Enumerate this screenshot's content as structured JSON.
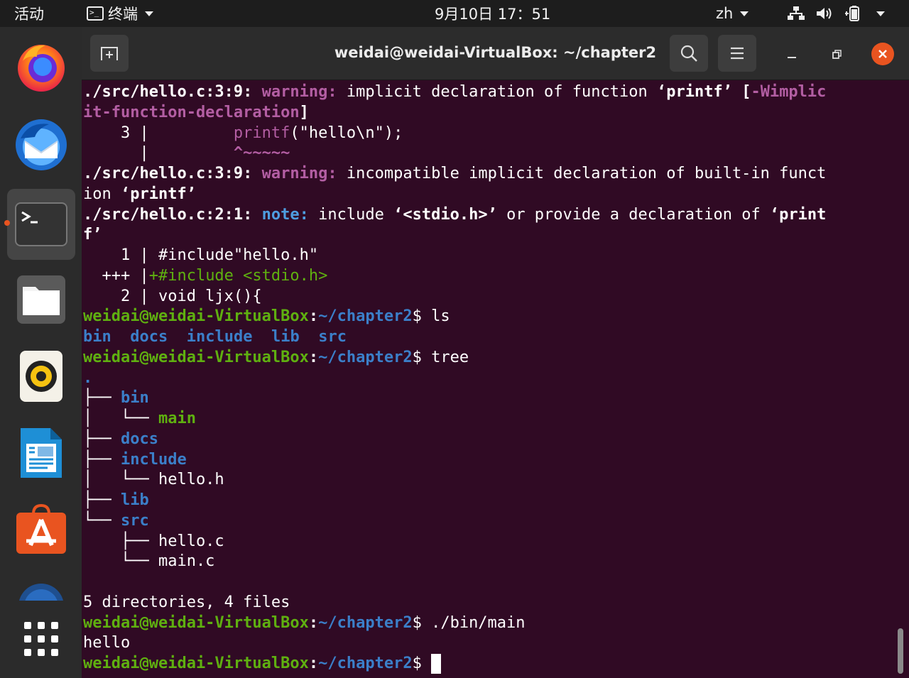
{
  "topbar": {
    "activities": "活动",
    "app_menu": "终端",
    "clock": "9月10日  17：51",
    "input_method": "zh"
  },
  "dock": {
    "items": [
      {
        "name": "firefox"
      },
      {
        "name": "thunderbird"
      },
      {
        "name": "terminal",
        "active": true
      },
      {
        "name": "files"
      },
      {
        "name": "rhythmbox"
      },
      {
        "name": "libreoffice-writer"
      },
      {
        "name": "ubuntu-software"
      },
      {
        "name": "help"
      },
      {
        "name": "show-applications"
      }
    ]
  },
  "window": {
    "title": "weidai@weidai-VirtualBox: ~/chapter2"
  },
  "terminal": {
    "prompt_user": "weidai@weidai-VirtualBox",
    "prompt_path": "~/chapter2",
    "lines": [
      {
        "segs": [
          {
            "t": "./src/hello.c:3:9: ",
            "c": "b"
          },
          {
            "t": "warning: ",
            "c": "warn"
          },
          {
            "t": "implicit declaration of function "
          },
          {
            "t": "‘printf’",
            "c": "b"
          },
          {
            "t": " [",
            "c": "b"
          },
          {
            "t": "-Wimplic",
            "c": "warn"
          }
        ]
      },
      {
        "segs": [
          {
            "t": "it-function-declaration",
            "c": "warn"
          },
          {
            "t": "]",
            "c": "b"
          }
        ]
      },
      {
        "segs": [
          {
            "t": "    3 |         "
          },
          {
            "t": "printf",
            "c": "magenta"
          },
          {
            "t": "(\"hello\\n\");"
          }
        ]
      },
      {
        "segs": [
          {
            "t": "      |         "
          },
          {
            "t": "^~~~~~",
            "c": "warn"
          }
        ]
      },
      {
        "segs": [
          {
            "t": "./src/hello.c:3:9: ",
            "c": "b"
          },
          {
            "t": "warning: ",
            "c": "warn"
          },
          {
            "t": "incompatible implicit declaration of built-in funct"
          }
        ]
      },
      {
        "segs": [
          {
            "t": "ion "
          },
          {
            "t": "‘printf’",
            "c": "b"
          }
        ]
      },
      {
        "segs": [
          {
            "t": "./src/hello.c:2:1: ",
            "c": "b"
          },
          {
            "t": "note: ",
            "c": "note"
          },
          {
            "t": "include "
          },
          {
            "t": "‘<stdio.h>’",
            "c": "b"
          },
          {
            "t": " or provide a declaration of "
          },
          {
            "t": "‘print",
            "c": "b"
          }
        ]
      },
      {
        "segs": [
          {
            "t": "f’",
            "c": "b"
          }
        ]
      },
      {
        "segs": [
          {
            "t": "    1 | #include\"hello.h\""
          }
        ]
      },
      {
        "segs": [
          {
            "t": "  +++ |"
          },
          {
            "t": "+#include <stdio.h>",
            "c": "gn"
          }
        ]
      },
      {
        "segs": [
          {
            "t": "    2 | void ljx(){"
          }
        ]
      },
      {
        "segs": [
          {
            "t": "weidai@weidai-VirtualBox",
            "c": "g"
          },
          {
            "t": ":",
            "c": "b"
          },
          {
            "t": "~/chapter2",
            "c": "bl"
          },
          {
            "t": "$ ls"
          }
        ]
      },
      {
        "segs": [
          {
            "t": "bin",
            "c": "dir"
          },
          {
            "t": "  "
          },
          {
            "t": "docs",
            "c": "dir"
          },
          {
            "t": "  "
          },
          {
            "t": "include",
            "c": "dir"
          },
          {
            "t": "  "
          },
          {
            "t": "lib",
            "c": "dir"
          },
          {
            "t": "  "
          },
          {
            "t": "src",
            "c": "dir"
          }
        ]
      },
      {
        "segs": [
          {
            "t": "weidai@weidai-VirtualBox",
            "c": "g"
          },
          {
            "t": ":",
            "c": "b"
          },
          {
            "t": "~/chapter2",
            "c": "bl"
          },
          {
            "t": "$ tree"
          }
        ]
      },
      {
        "segs": [
          {
            "t": ".",
            "c": "dir"
          }
        ]
      },
      {
        "segs": [
          {
            "t": "├── "
          },
          {
            "t": "bin",
            "c": "dir"
          }
        ]
      },
      {
        "segs": [
          {
            "t": "│   └── "
          },
          {
            "t": "main",
            "c": "g"
          }
        ]
      },
      {
        "segs": [
          {
            "t": "├── "
          },
          {
            "t": "docs",
            "c": "dir"
          }
        ]
      },
      {
        "segs": [
          {
            "t": "├── "
          },
          {
            "t": "include",
            "c": "dir"
          }
        ]
      },
      {
        "segs": [
          {
            "t": "│   └── hello.h"
          }
        ]
      },
      {
        "segs": [
          {
            "t": "├── "
          },
          {
            "t": "lib",
            "c": "dir"
          }
        ]
      },
      {
        "segs": [
          {
            "t": "└── "
          },
          {
            "t": "src",
            "c": "dir"
          }
        ]
      },
      {
        "segs": [
          {
            "t": "    ├── hello.c"
          }
        ]
      },
      {
        "segs": [
          {
            "t": "    └── main.c"
          }
        ]
      },
      {
        "segs": [
          {
            "t": ""
          }
        ]
      },
      {
        "segs": [
          {
            "t": "5 directories, 4 files"
          }
        ]
      },
      {
        "segs": [
          {
            "t": "weidai@weidai-VirtualBox",
            "c": "g"
          },
          {
            "t": ":",
            "c": "b"
          },
          {
            "t": "~/chapter2",
            "c": "bl"
          },
          {
            "t": "$ ./bin/main"
          }
        ]
      },
      {
        "segs": [
          {
            "t": "hello"
          }
        ]
      },
      {
        "segs": [
          {
            "t": "weidai@weidai-VirtualBox",
            "c": "g"
          },
          {
            "t": ":",
            "c": "b"
          },
          {
            "t": "~/chapter2",
            "c": "bl"
          },
          {
            "t": "$ "
          }
        ],
        "cursor": true
      }
    ]
  },
  "colors": {
    "terminal_bg": "#300a24",
    "prompt_green": "#5fb010",
    "path_blue": "#3b7fc9",
    "warning_magenta": "#b35ea3",
    "note_blue": "#4e9de0",
    "ubuntu_orange": "#e95420"
  }
}
